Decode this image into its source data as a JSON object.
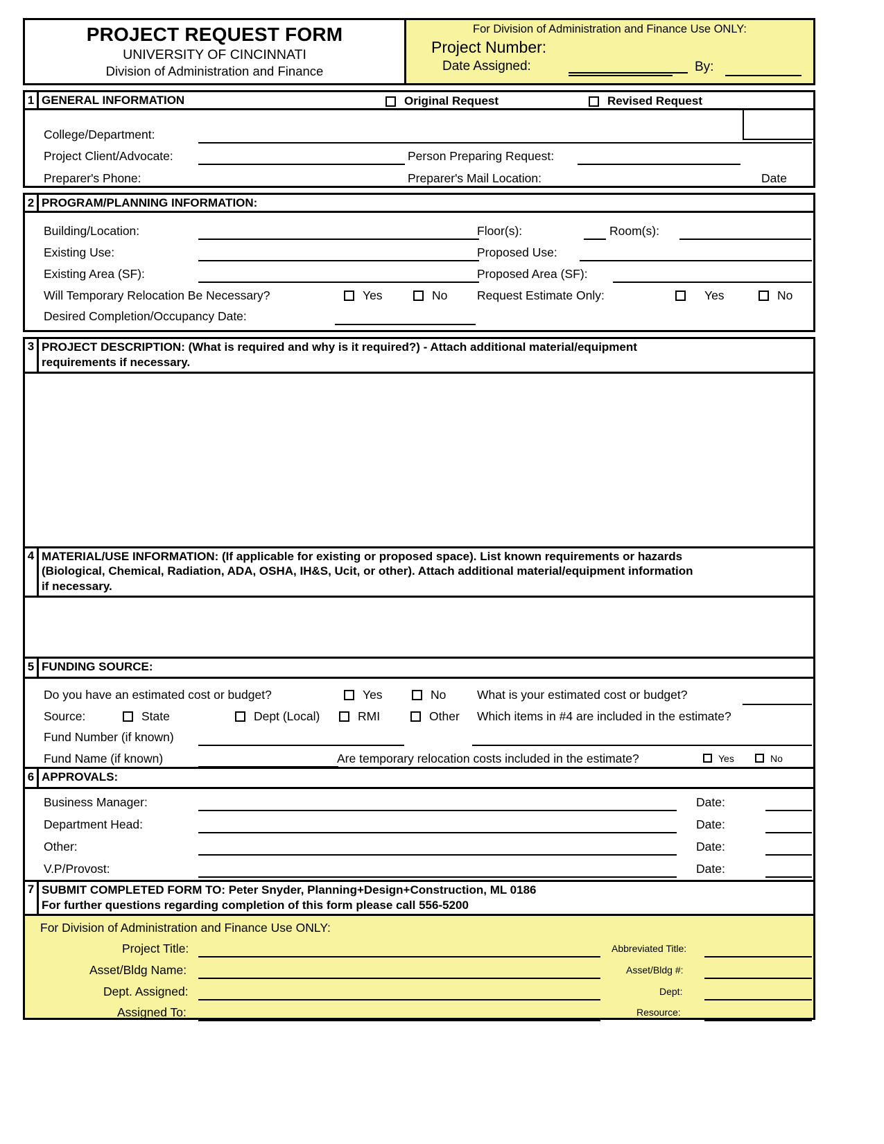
{
  "header": {
    "title": "PROJECT REQUEST FORM",
    "university": "UNIVERSITY OF CINCINNATI",
    "division": "Division of Administration and Finance",
    "use_only": "For Division of Administration and Finance Use ONLY:",
    "project_number_label": "Project Number:",
    "date_assigned_label": "Date Assigned:",
    "by_label": "By:"
  },
  "section1": {
    "number": "1",
    "title": "GENERAL INFORMATION",
    "original_request": "Original Request",
    "revised_request": "Revised Request",
    "college_department": "College/Department:",
    "project_client": "Project Client/Advocate:",
    "person_preparing": "Person Preparing Request:",
    "preparers_phone": "Preparer's Phone:",
    "preparers_mail": "Preparer's Mail Location:",
    "date": "Date"
  },
  "section2": {
    "number": "2",
    "title": "PROGRAM/PLANNING INFORMATION:",
    "building_location": "Building/Location:",
    "floors": "Floor(s):",
    "rooms": "Room(s):",
    "existing_use": "Existing Use:",
    "proposed_use": "Proposed Use:",
    "existing_area": "Existing Area (SF):",
    "proposed_area": "Proposed Area (SF):",
    "relocation_question": "Will Temporary Relocation Be Necessary?",
    "relocation_yes": "Yes",
    "relocation_no": "No",
    "estimate_only": "Request Estimate Only:",
    "estimate_yes": "Yes",
    "estimate_no": "No",
    "completion_date": "Desired Completion/Occupancy Date:"
  },
  "section3": {
    "number": "3",
    "title_line1": "PROJECT DESCRIPTION: (What is required and why is it required?) - Attach additional material/equipment",
    "title_line2": "requirements if necessary."
  },
  "section4": {
    "number": "4",
    "title_line1": "MATERIAL/USE INFORMATION: (If applicable for existing or proposed space). List known requirements or hazards",
    "title_line2": "(Biological, Chemical, Radiation, ADA, OSHA, IH&S, Ucit, or other). Attach additional material/equipment information",
    "title_line3": "if necessary."
  },
  "section5": {
    "number": "5",
    "title": "FUNDING SOURCE:",
    "budget_question": "Do you have an estimated cost or budget?",
    "budget_yes": "Yes",
    "budget_no": "No",
    "estimated_cost_question": "What is your estimated cost or budget?",
    "source_label": "Source:",
    "source_state": "State",
    "source_dept_local": "Dept (Local)",
    "source_rmi": "RMI",
    "source_other": "Other",
    "items_question": "Which items in #4 are included in the estimate?",
    "fund_number": "Fund Number (if known)",
    "fund_name": "Fund Name (if known)",
    "relocation_costs_question": "Are temporary relocation costs included in the estimate?",
    "relocation_costs_yes": "Yes",
    "relocation_costs_no": "No"
  },
  "section6": {
    "number": "6",
    "title": "APPROVALS:",
    "rows": [
      {
        "label": "Business Manager:",
        "date_label": "Date:"
      },
      {
        "label": "Department Head:",
        "date_label": "Date:"
      },
      {
        "label": "Other:",
        "date_label": "Date:"
      },
      {
        "label": "V.P/Provost:",
        "date_label": "Date:"
      }
    ]
  },
  "section7": {
    "number": "7",
    "line1": "SUBMIT COMPLETED FORM TO:  Peter Snyder, Planning+Design+Construction, ML 0186",
    "line2": "For further questions regarding completion of this form please call 556-5200"
  },
  "footer": {
    "use_only": "For Division of Administration and Finance Use ONLY:",
    "left_rows": [
      "Project Title:",
      "Asset/Bldg Name:",
      "Dept. Assigned:",
      "Assigned To:"
    ],
    "right_rows": [
      "Abbreviated Title:",
      "Asset/Bldg #:",
      "Dept:",
      "Resource:"
    ]
  },
  "colors": {
    "highlight": "#f7f39f",
    "ink": "#000000",
    "paper": "#ffffff"
  }
}
